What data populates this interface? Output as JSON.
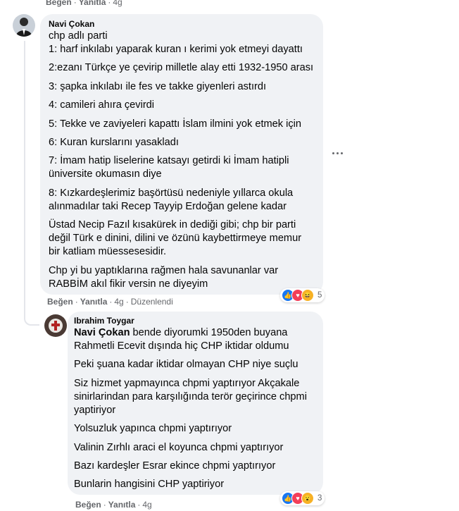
{
  "top_actions": {
    "like": "Beğen",
    "reply": "Yanıtla",
    "time": "4g"
  },
  "comment1": {
    "author": "Navi Çokan",
    "paragraphs": [
      [
        "chp adlı parti",
        "1: harf inkılabı yaparak kuran ı kerimi yok etmeyi dayattı"
      ],
      [
        "2:ezanı Türkçe ye çevirip milletle alay etti 1932-1950 arası"
      ],
      [
        "3: şapka inkılabı ile fes ve takke giyenleri astırdı"
      ],
      [
        "4: camileri ahıra çevirdi"
      ],
      [
        "5: Tekke ve zaviyeleri kapattı İslam ilmini yok etmek için"
      ],
      [
        "6: Kuran kurslarını yasakladı"
      ],
      [
        "7: İmam hatip liselerine katsayı getirdi ki İmam hatipli",
        "üniversite okumasın diye"
      ],
      [
        "8: Kızkardeşlerimiz başörtüsü nedeniyle yıllarca okula",
        "alınmadılar taki Recep Tayyip Erdoğan gelene kadar"
      ],
      [
        "Üstad Necip Fazıl kısakürek in dediği gibi; chp bir parti",
        "değil Türk e dinini, dilini ve özünü kaybettirmeye memur",
        "bir katliam müessesesidir."
      ],
      [
        "Chp yi bu yaptıklarına rağmen hala savunanlar var",
        "RABBİM akıl fikir versin ne diyeyim"
      ]
    ],
    "reaction_count": "5",
    "actions": {
      "like": "Beğen",
      "reply": "Yanıtla",
      "time": "4g",
      "edited": "Düzenlendi"
    }
  },
  "reply1": {
    "author": "Ibrahim Toygar",
    "mention": "Navi Çokan",
    "first_line_rest": " bende diyorumki 1950den buyana",
    "paragraphs": [
      [
        "Rahmetli Ecevit dışında hiç CHP iktidar oldumu"
      ],
      [
        "Peki şuana kadar iktidar olmayan CHP niye suçlu"
      ],
      [
        "Siz hizmet yapmayınca chpmi yaptırıyor Akçakale",
        "sinirlarindan para karşılığında terör geçirince chpmi",
        "yaptiriyor"
      ],
      [
        "Yolsuzluk yapınca chpmi yaptırıyor"
      ],
      [
        "Valinin Zırhlı araci el koyunca chpmi yaptırıyor"
      ],
      [
        "Bazı kardeşler Esrar ekince chpmi yaptırıyor"
      ],
      [
        "Bunlarin hangisini CHP yaptiriyor"
      ]
    ],
    "reaction_count": "3",
    "actions": {
      "like": "Beğen",
      "reply": "Yanıtla",
      "time": "4g"
    }
  }
}
